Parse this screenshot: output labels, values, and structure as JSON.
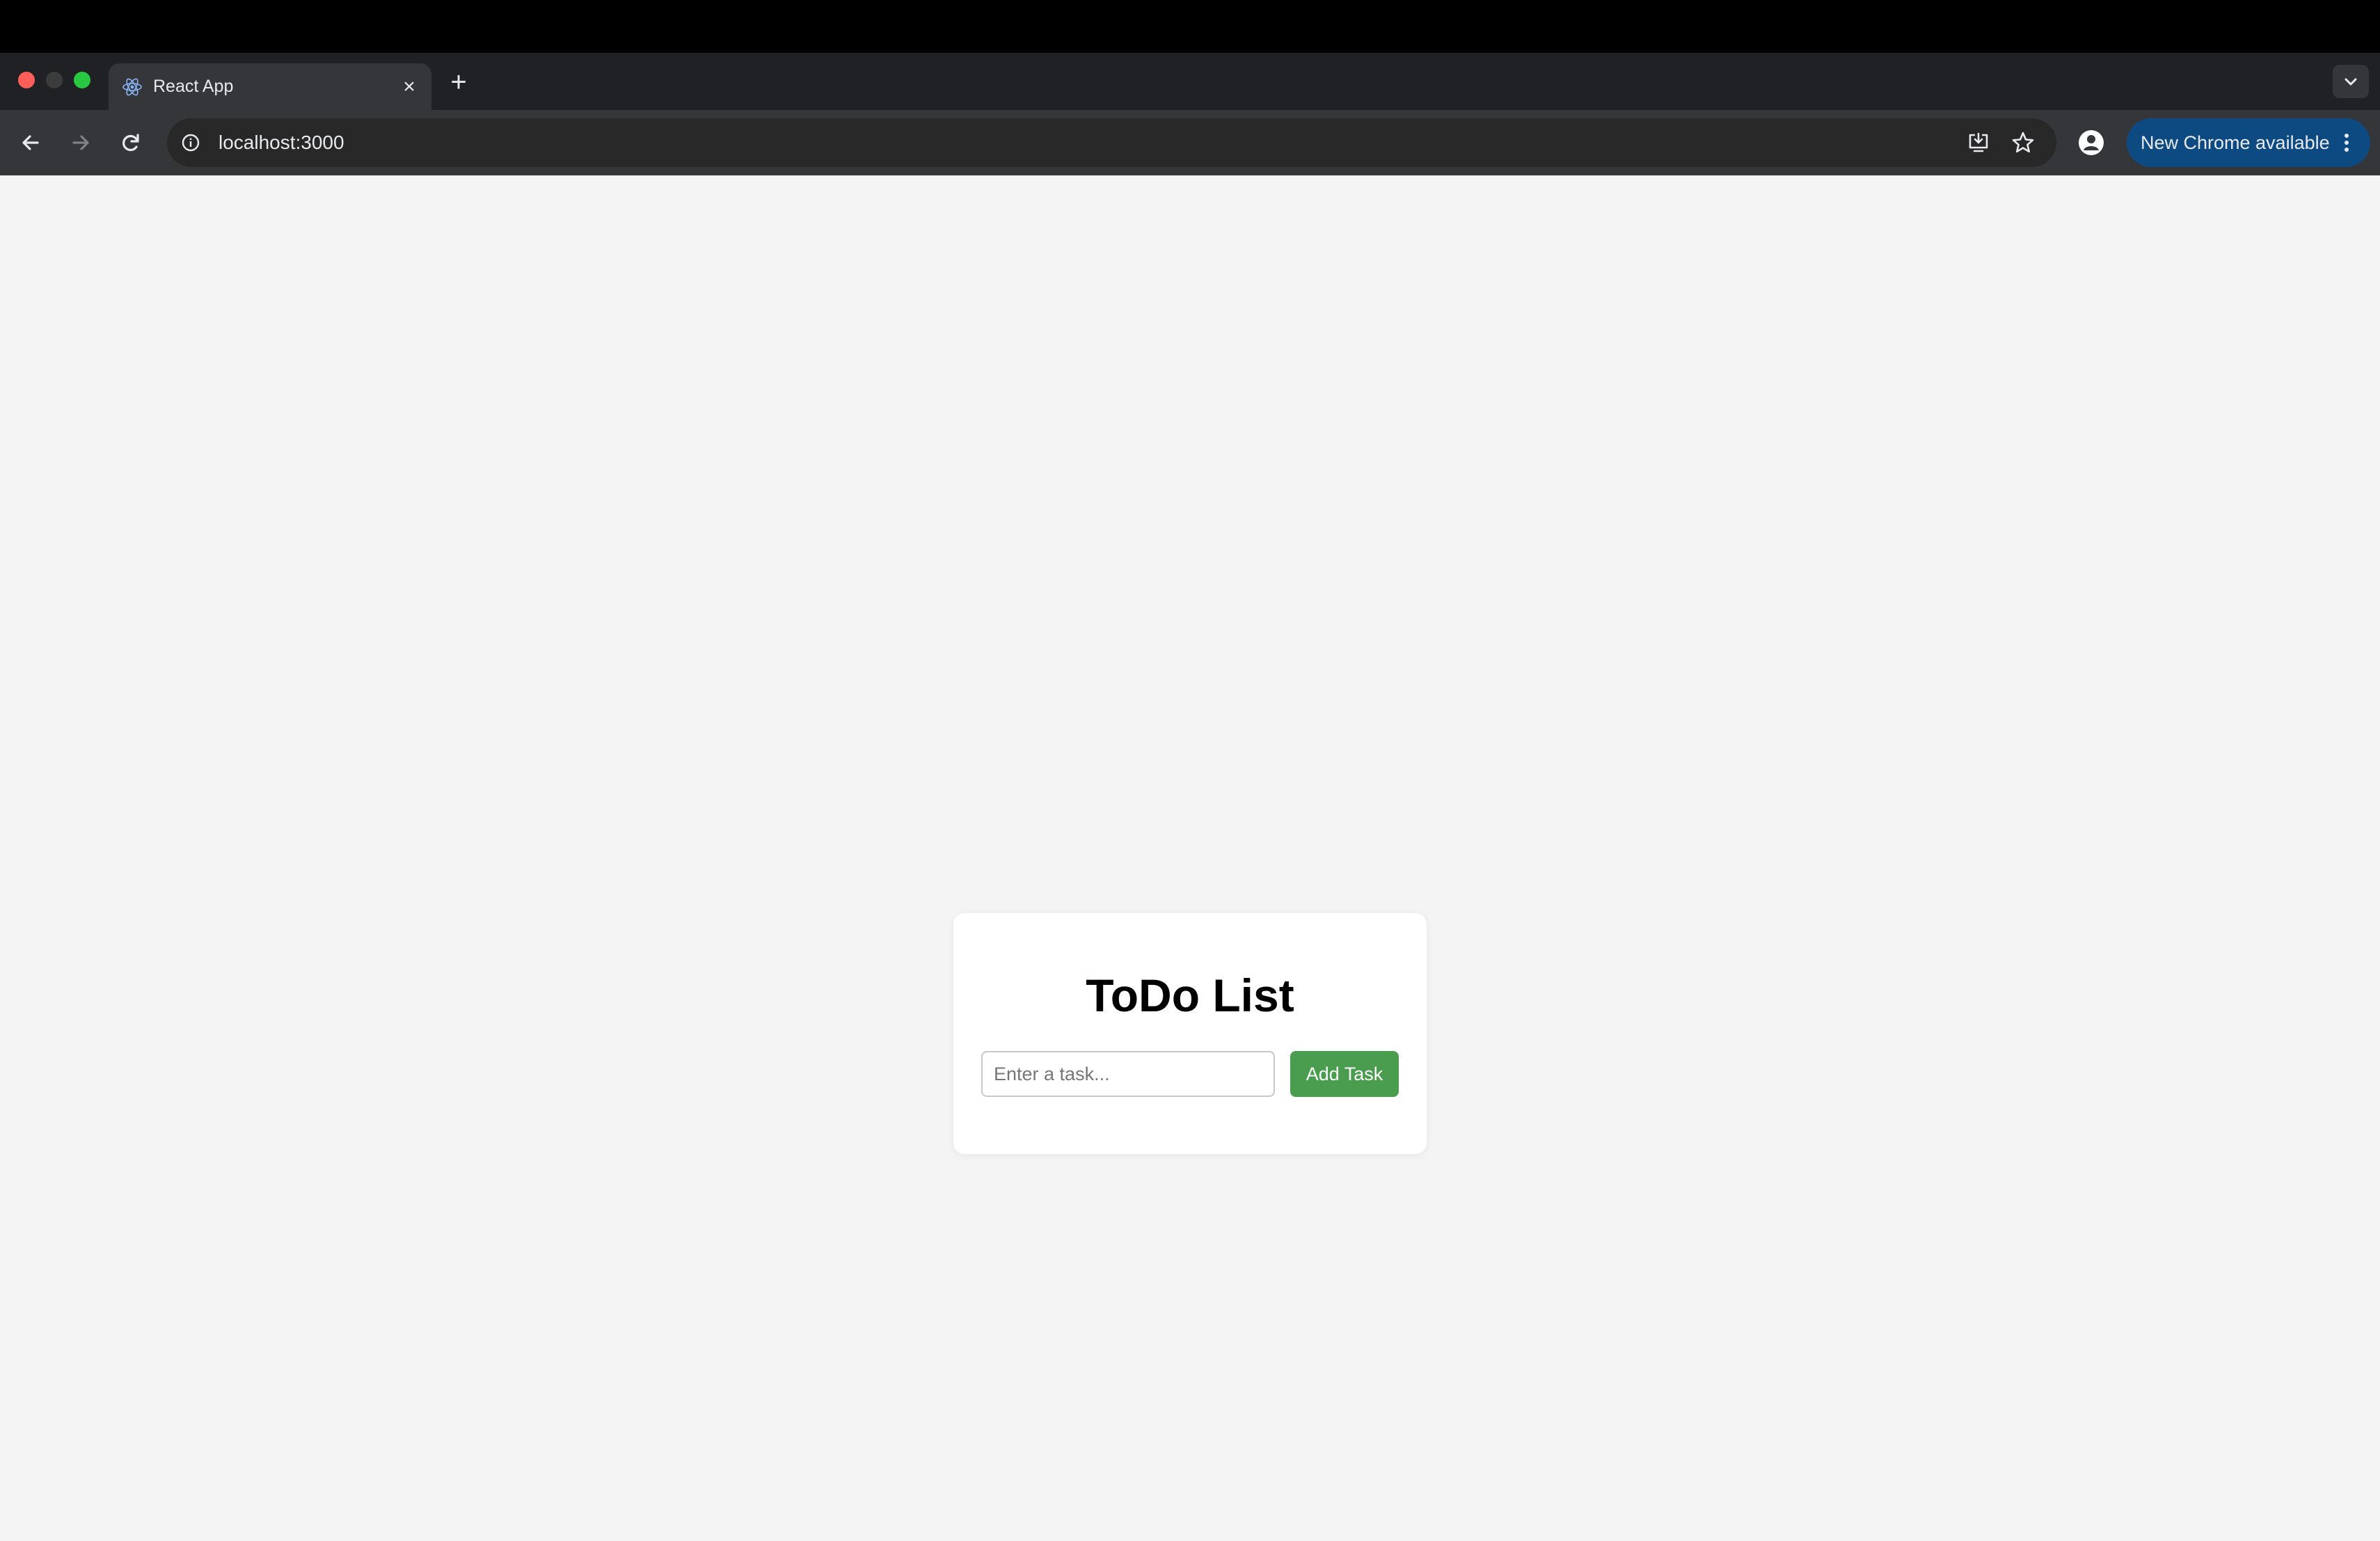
{
  "browser": {
    "tab": {
      "title": "React App",
      "favicon_icon": "react-logo-icon",
      "close_icon": "close-icon",
      "close_glyph": "×"
    },
    "new_tab_glyph": "+",
    "address_bar": {
      "url": "localhost:3000"
    },
    "update_button": {
      "label": "New Chrome available"
    },
    "colors": {
      "tab_bar": "#202124",
      "toolbar": "#35363a",
      "update_button": "#0e4a82"
    }
  },
  "app": {
    "title": "ToDo List",
    "task_input": {
      "placeholder": "Enter a task...",
      "value": ""
    },
    "add_button": {
      "label": "Add Task"
    },
    "colors": {
      "background": "#f4f4f4",
      "card": "#ffffff",
      "accent": "#4a9d4e"
    }
  }
}
